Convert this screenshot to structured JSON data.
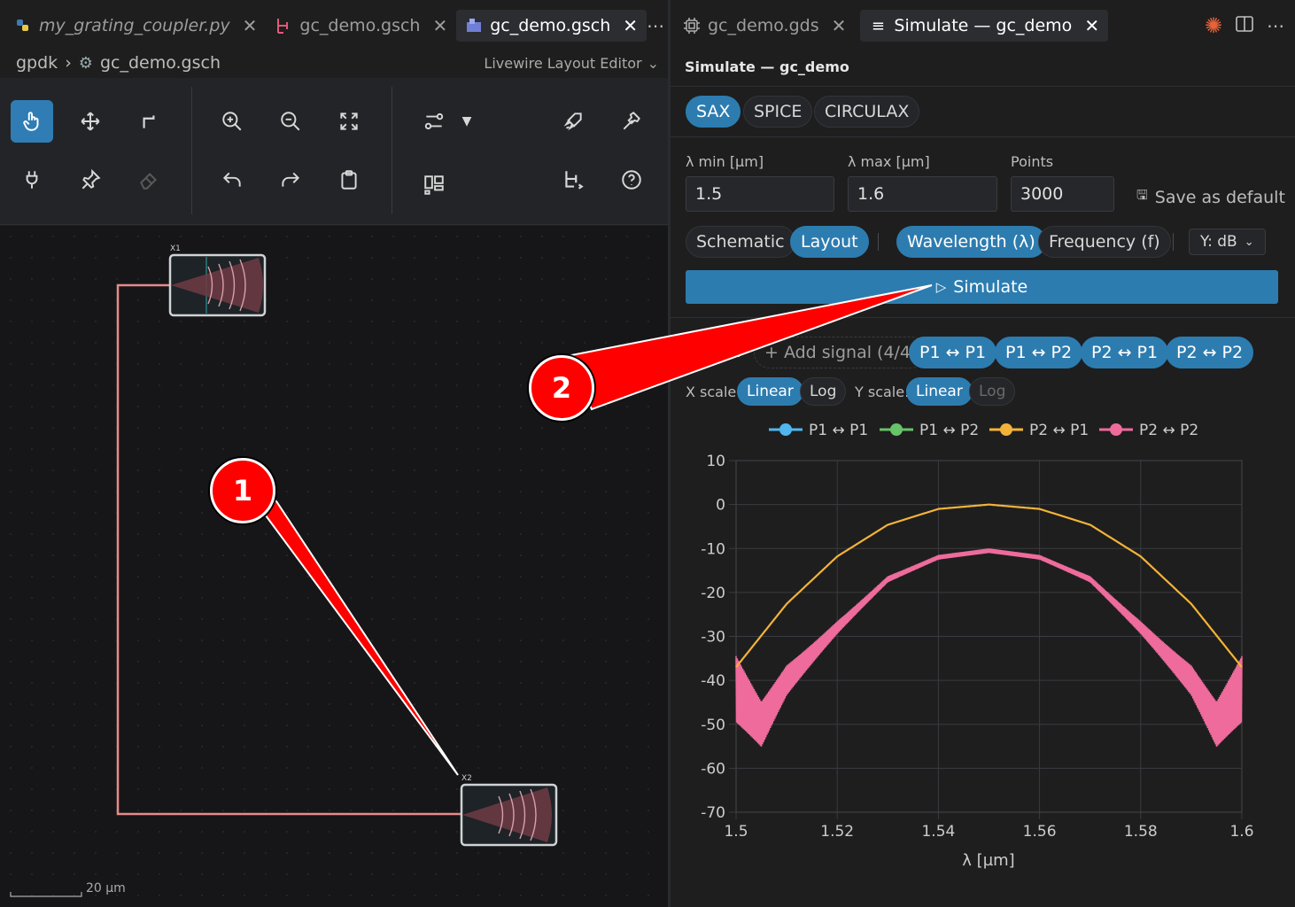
{
  "left_tabs": [
    {
      "label": "my_grating_coupler.py",
      "icon": "python-icon"
    },
    {
      "label": "gc_demo.gsch",
      "icon": "schematic-icon"
    },
    {
      "label": "gc_demo.gsch",
      "icon": "layout-editor-icon"
    }
  ],
  "right_tabs": [
    {
      "label": "gc_demo.gds",
      "icon": "chip-icon"
    },
    {
      "label": "Simulate — gc_demo",
      "icon": "list-icon"
    }
  ],
  "breadcrumb": {
    "root": "gpdk",
    "file": "gc_demo.gsch",
    "editor_mode": "Livewire Layout Editor"
  },
  "canvas": {
    "instance_1": "X1",
    "instance_2": "X2",
    "scale_bar": "20 µm"
  },
  "simulate": {
    "title": "Simulate — gc_demo",
    "engines": [
      "SAX",
      "SPICE",
      "CIRCULAX"
    ],
    "active_engine": "SAX",
    "lambda_min_label": "λ min [µm]",
    "lambda_min": "1.5",
    "lambda_max_label": "λ max [µm]",
    "lambda_max": "1.6",
    "points_label": "Points",
    "points": "3000",
    "save_default": "Save as default",
    "source_schematic": "Schematic",
    "source_layout": "Layout",
    "x_wavelength": "Wavelength (λ)",
    "x_frequency": "Frequency (f)",
    "y_unit": "Y: dB",
    "simulate_button": "Simulate",
    "signals_label": "Signals:",
    "add_signal": "+ Add signal (4/4)",
    "signals": [
      "P1 ↔ P1",
      "P1 ↔ P2",
      "P2 ↔ P1",
      "P2 ↔ P2"
    ],
    "x_scale_label": "X scale:",
    "y_scale_label": "Y scale:",
    "scale_linear": "Linear",
    "scale_log": "Log"
  },
  "callouts": [
    "1",
    "2"
  ],
  "chart_data": {
    "type": "line",
    "title": "",
    "xlabel": "λ [µm]",
    "ylabel": "",
    "xlim": [
      1.5,
      1.6
    ],
    "ylim": [
      -70,
      10
    ],
    "xticks": [
      1.5,
      1.52,
      1.54,
      1.56,
      1.58,
      1.6
    ],
    "yticks": [
      10,
      0,
      -10,
      -20,
      -30,
      -40,
      -50,
      -60,
      -70
    ],
    "grid": true,
    "legend": "top",
    "series": [
      {
        "name": "P1 ↔ P1",
        "color": "#4fb7ee",
        "x": [
          1.5,
          1.51,
          1.52,
          1.53,
          1.54,
          1.55,
          1.56,
          1.57,
          1.58,
          1.59,
          1.6
        ],
        "y": [
          -40,
          -44,
          -47,
          -48,
          -45,
          -42,
          -45,
          -48,
          -47,
          -44,
          -40
        ],
        "dashed": true
      },
      {
        "name": "P1 ↔ P2",
        "color": "#67c26a",
        "x": [
          1.5,
          1.51,
          1.52,
          1.53,
          1.54,
          1.55,
          1.56,
          1.57,
          1.58,
          1.59,
          1.6
        ],
        "y": [
          -37,
          -22.6,
          -11.8,
          -4.6,
          -1.0,
          0,
          -1.0,
          -4.6,
          -11.8,
          -22.6,
          -37
        ]
      },
      {
        "name": "P2 ↔ P1",
        "color": "#f3b338",
        "x": [
          1.5,
          1.51,
          1.52,
          1.53,
          1.54,
          1.55,
          1.56,
          1.57,
          1.58,
          1.59,
          1.6
        ],
        "y": [
          -37,
          -22.6,
          -11.8,
          -4.6,
          -1.0,
          0,
          -1.0,
          -4.6,
          -11.8,
          -22.6,
          -37
        ]
      },
      {
        "name": "P2 ↔ P2",
        "color": "#ee6b9c",
        "x": [
          1.5,
          1.505,
          1.51,
          1.52,
          1.53,
          1.54,
          1.55,
          1.56,
          1.57,
          1.58,
          1.59,
          1.595,
          1.6
        ],
        "y": [
          -42,
          -50,
          -40,
          -28,
          -17,
          -12,
          -10.5,
          -12,
          -17,
          -28,
          -40,
          -50,
          -42
        ]
      }
    ]
  }
}
